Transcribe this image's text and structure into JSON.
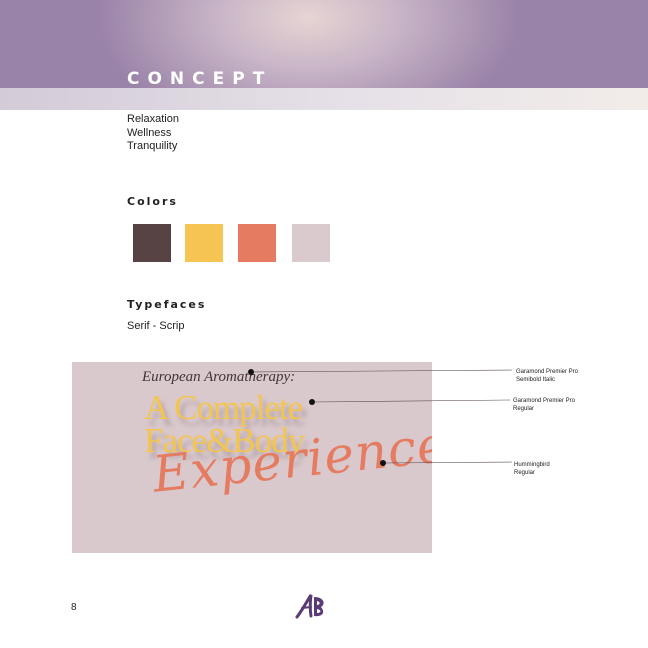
{
  "header": {
    "title": "CONCEPT"
  },
  "concept": {
    "items": [
      "Relaxation",
      "Wellness",
      "Tranquility"
    ]
  },
  "colors": {
    "heading": "Colors",
    "swatches": [
      "#574244",
      "#f5c453",
      "#e57c62",
      "#dac9cd"
    ]
  },
  "typefaces": {
    "heading": "Typefaces",
    "subheading": "Serif - Scrip",
    "sample": {
      "line1": "European Aromatherapy:",
      "line2": "A Complete",
      "line3": "Face&Body",
      "line4": "Experience"
    },
    "callouts": [
      {
        "name": "Garamond Premier Pro",
        "style": "Semibold Italic"
      },
      {
        "name": "Garamond Premier Pro",
        "style": "Regular"
      },
      {
        "name": "Hummingbird",
        "style": "Regular"
      }
    ]
  },
  "footer": {
    "page_number": "8",
    "logo_text": "AB"
  }
}
